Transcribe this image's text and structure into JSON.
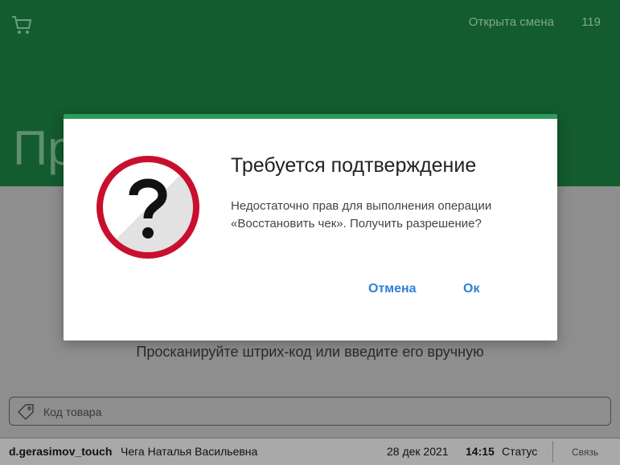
{
  "header": {
    "cart_icon": "shopping-cart-icon",
    "shift_status": "Открыта смена",
    "shift_number": "119",
    "page_title": "Пр"
  },
  "main": {
    "scan_hint": "Просканируйте штрих-код или введите его вручную",
    "search": {
      "placeholder": "Код товара",
      "value": "",
      "icon": "tag-icon"
    }
  },
  "status_bar": {
    "user": "d.gerasimov_touch",
    "full_name": "Чега Наталья Васильевна",
    "date": "28 дек 2021",
    "time": "14:15",
    "status": "Статус",
    "link": "Связь"
  },
  "dialog": {
    "icon": "question-icon",
    "title": "Требуется подтверждение",
    "message": "Недостаточно прав для выполнения операции «Восстановить чек». Получить разрешение?",
    "cancel_label": "Отмена",
    "ok_label": "Ок"
  },
  "colors": {
    "header_bg": "#135c2f",
    "accent": "#2e9b5d",
    "button_text": "#2f7fd4",
    "icon_ring": "#c8102e"
  }
}
